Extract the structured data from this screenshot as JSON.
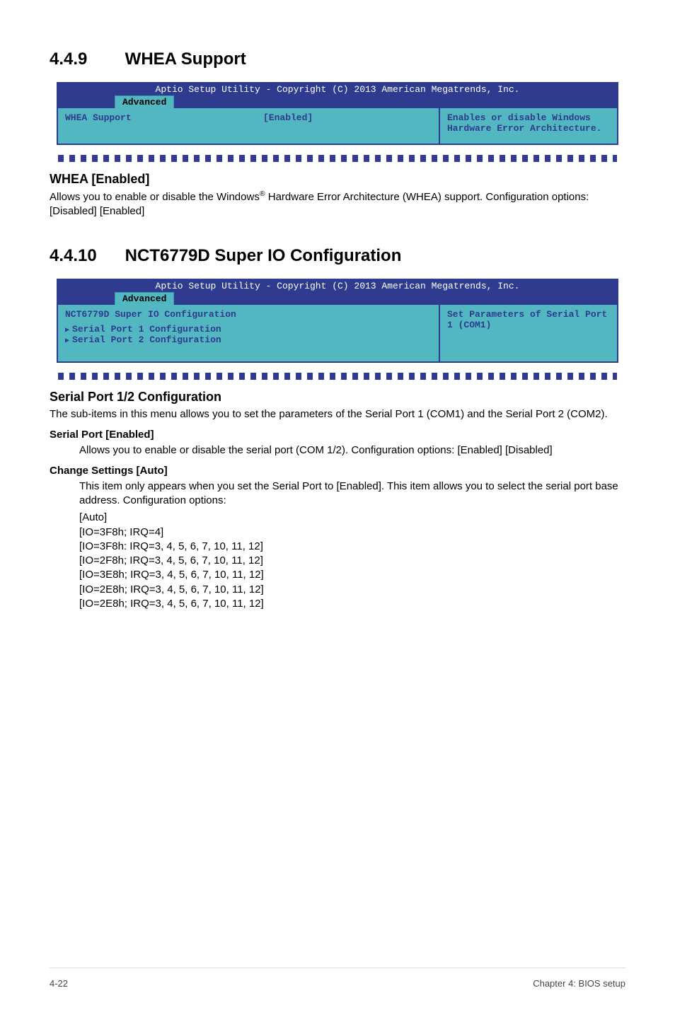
{
  "section1": {
    "number": "4.4.9",
    "title": "WHEA Support",
    "bios": {
      "copyright": "Aptio Setup Utility - Copyright (C) 2013 American Megatrends, Inc.",
      "tab": "Advanced",
      "item_label": "WHEA Support",
      "item_value": "[Enabled]",
      "help": "Enables or disable Windows Hardware Error Architecture."
    },
    "heading": "WHEA [Enabled]",
    "para_pre": "Allows you to enable or disable the Windows",
    "para_post": " Hardware Error Architecture (WHEA) support. Configuration options: [Disabled] [Enabled]"
  },
  "section2": {
    "number": "4.4.10",
    "title": "NCT6779D Super IO Configuration",
    "bios": {
      "copyright": "Aptio Setup Utility - Copyright (C) 2013 American Megatrends, Inc.",
      "tab": "Advanced",
      "heading": "NCT6779D Super IO Configuration",
      "item1": "Serial Port 1 Configuration",
      "item2": "Serial Port 2 Configuration",
      "help": "Set Parameters of Serial Port 1 (COM1)"
    },
    "h3": "Serial Port 1/2 Configuration",
    "p1": "The sub-items in this menu allows you to set the parameters of the Serial Port 1 (COM1) and the Serial Port 2 (COM2).",
    "sp_heading": "Serial Port [Enabled]",
    "sp_body": "Allows you to enable or disable the serial port (COM 1/2). Configuration options: [Enabled] [Disabled]",
    "cs_heading": "Change Settings [Auto]",
    "cs_body_intro": "This item only appears when you set the Serial Port to [Enabled]. This item allows you to select the serial port base address. Configuration options:",
    "cs_lines": {
      "l0": "[Auto]",
      "l1": "[IO=3F8h; IRQ=4]",
      "l2": "[IO=3F8h: IRQ=3, 4, 5, 6, 7, 10, 11, 12]",
      "l3": "[IO=2F8h; IRQ=3, 4, 5, 6, 7, 10, 11, 12]",
      "l4": "[IO=3E8h; IRQ=3, 4, 5, 6, 7, 10, 11, 12]",
      "l5": "[IO=2E8h; IRQ=3, 4, 5, 6, 7, 10, 11, 12]",
      "l6": "[IO=2E8h; IRQ=3, 4, 5, 6, 7, 10, 11, 12]"
    }
  },
  "footer": {
    "left": "4-22",
    "right": "Chapter 4: BIOS setup"
  }
}
